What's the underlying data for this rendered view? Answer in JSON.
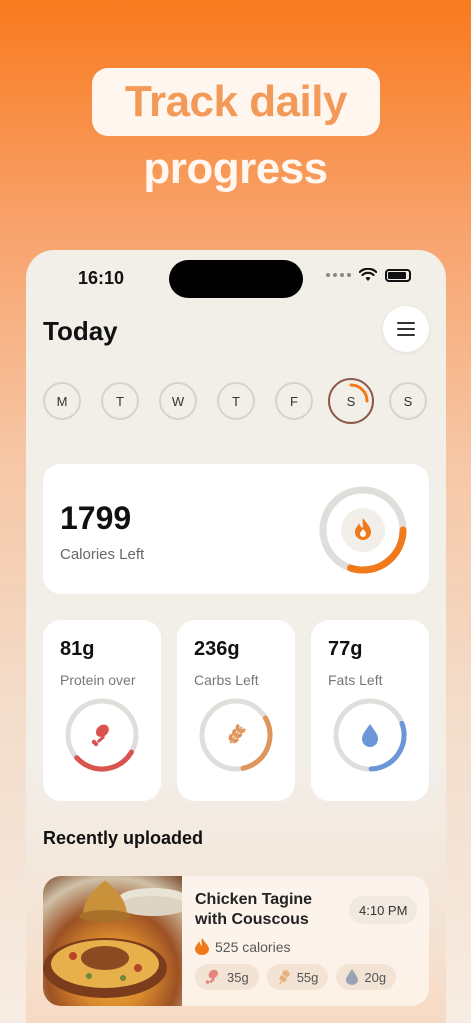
{
  "headline": {
    "line1": "Track daily",
    "line2": "progress"
  },
  "status_bar": {
    "time": "16:10",
    "icons": [
      "signal-icon",
      "wifi-icon",
      "battery-icon"
    ]
  },
  "header": {
    "title": "Today",
    "menu_icon": "hamburger-menu-icon"
  },
  "week": {
    "days": [
      "M",
      "T",
      "W",
      "T",
      "F",
      "S",
      "S"
    ],
    "selected_index": 5,
    "selected_progress": 0.25
  },
  "calories": {
    "value": "1799",
    "label": "Calories Left",
    "progress": 0.3,
    "icon": "flame-icon",
    "accent": "#f07a1a"
  },
  "macros": [
    {
      "value": "81g",
      "label": "Protein over",
      "icon": "drumstick-icon",
      "color": "#d9534f",
      "progress": 0.3
    },
    {
      "value": "236g",
      "label": "Carbs Left",
      "icon": "wheat-icon",
      "color": "#e0955a",
      "progress": 0.3
    },
    {
      "value": "77g",
      "label": "Fats Left",
      "icon": "water-drop-icon",
      "color": "#6b96d8",
      "progress": 0.3
    }
  ],
  "recent": {
    "title": "Recently uploaded",
    "meal": {
      "name": "Chicken Tagine with Couscous",
      "time": "4:10 PM",
      "calories": "525 calories",
      "chips": [
        {
          "icon": "drumstick-icon",
          "value": "35g"
        },
        {
          "icon": "wheat-icon",
          "value": "55g"
        },
        {
          "icon": "water-drop-icon",
          "value": "20g"
        }
      ]
    }
  },
  "colors": {
    "accent": "#f07a1a",
    "protein": "#d9534f",
    "carbs": "#e0955a",
    "fats": "#6b96d8"
  }
}
